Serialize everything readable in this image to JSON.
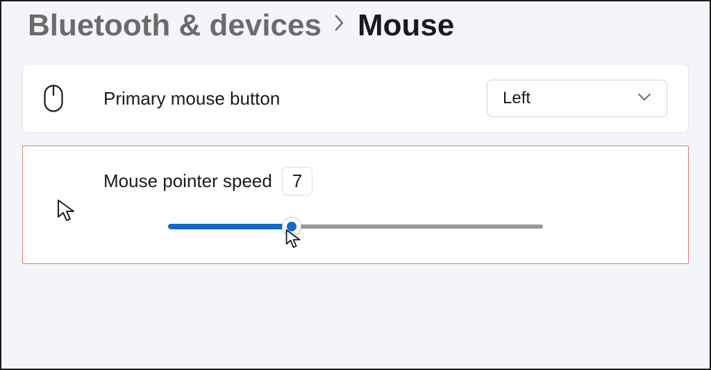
{
  "breadcrumb": {
    "parent": "Bluetooth & devices",
    "current": "Mouse"
  },
  "primaryButton": {
    "label": "Primary mouse button",
    "selected": "Left"
  },
  "pointerSpeed": {
    "label": "Mouse pointer speed",
    "value": "7",
    "min": 1,
    "max": 20,
    "sliderPercent": 33
  }
}
